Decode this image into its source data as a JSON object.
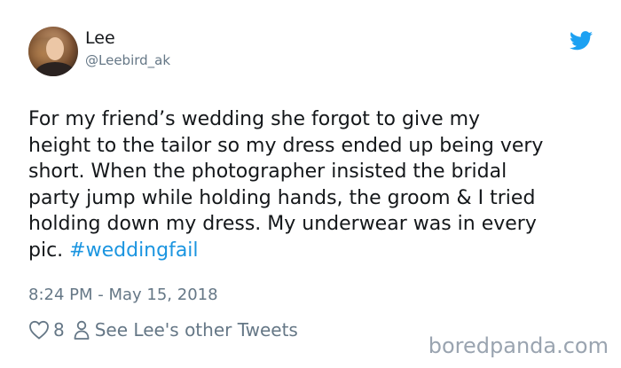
{
  "author": {
    "display_name": "Lee",
    "handle": "@Leebird_ak"
  },
  "tweet": {
    "text": "For my friend’s wedding she forgot to give my\nheight to the tailor so my dress ended up being very\nshort. When the photographer insisted the bridal\nparty jump while holding hands, the groom & I tried\nholding down my dress. My underwear was in every\npic. ",
    "hashtag": "#weddingfail",
    "timestamp": "8:24 PM - May 15, 2018"
  },
  "actions": {
    "like_icon": "heart-icon",
    "likes_count": "8",
    "person_icon": "person-icon",
    "other_tweets_label": "See Lee's other Tweets"
  },
  "watermark": "boredpanda.com",
  "colors": {
    "link": "#1b95e0",
    "secondary": "#657786",
    "text": "#14171a"
  }
}
